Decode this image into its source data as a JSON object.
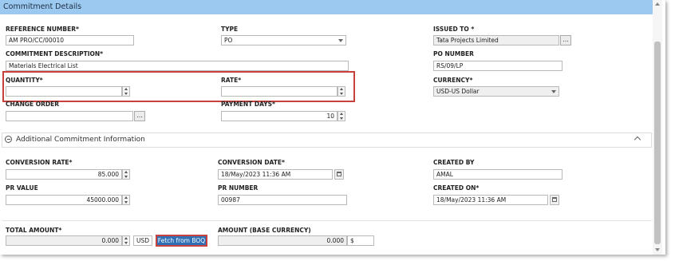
{
  "header": {
    "title": "Commitment Details"
  },
  "fields": {
    "reference_number": {
      "label": "REFERENCE NUMBER*",
      "value": "AM PRO/CC/00010"
    },
    "type": {
      "label": "TYPE",
      "value": "PO"
    },
    "issued_to": {
      "label": "ISSUED TO *",
      "value": "Tata Projects Limited",
      "button": "..."
    },
    "commitment_description": {
      "label": "COMMITMENT DESCRIPTION*",
      "value": "Materials Electrical List"
    },
    "po_number": {
      "label": "PO NUMBER",
      "value": "RS/09/LP"
    },
    "quantity": {
      "label": "QUANTITY*",
      "value": ""
    },
    "rate": {
      "label": "RATE*",
      "value": ""
    },
    "currency": {
      "label": "CURRENCY*",
      "value": "USD-US Dollar"
    },
    "change_order": {
      "label": "CHANGE ORDER",
      "value": "",
      "button": "..."
    },
    "payment_days": {
      "label": "PAYMENT DAYS*",
      "value": "10"
    }
  },
  "additional": {
    "title": "Additional Commitment Information",
    "conversion_rate": {
      "label": "CONVERSION RATE*",
      "value": "85.000"
    },
    "conversion_date": {
      "label": "CONVERSION DATE*",
      "value": "18/May/2023 11:36 AM"
    },
    "created_by": {
      "label": "CREATED BY",
      "value": "AMAL"
    },
    "pr_value": {
      "label": "PR VALUE",
      "value": "45000.000"
    },
    "pr_number": {
      "label": "PR NUMBER",
      "value": "00987"
    },
    "created_on": {
      "label": "CREATED ON*",
      "value": "18/May/2023 11:36 AM"
    }
  },
  "totals": {
    "total_amount": {
      "label": "TOTAL AMOUNT*",
      "value": "0.000",
      "unit": "USD"
    },
    "fetch_button": "Fetch from BOQ",
    "amount_base": {
      "label": "AMOUNT (BASE CURRENCY)",
      "value": "0.000",
      "unit": "$"
    }
  },
  "colors": {
    "header": "#9cc9f0",
    "highlight": "#c9413c",
    "fetch_button": "#2f6fb5"
  },
  "icons": [
    "ellipsis-icon",
    "dropdown-caret-icon",
    "spinner-icon",
    "calendar-icon",
    "collapse-minus-icon",
    "chevron-up-icon"
  ]
}
